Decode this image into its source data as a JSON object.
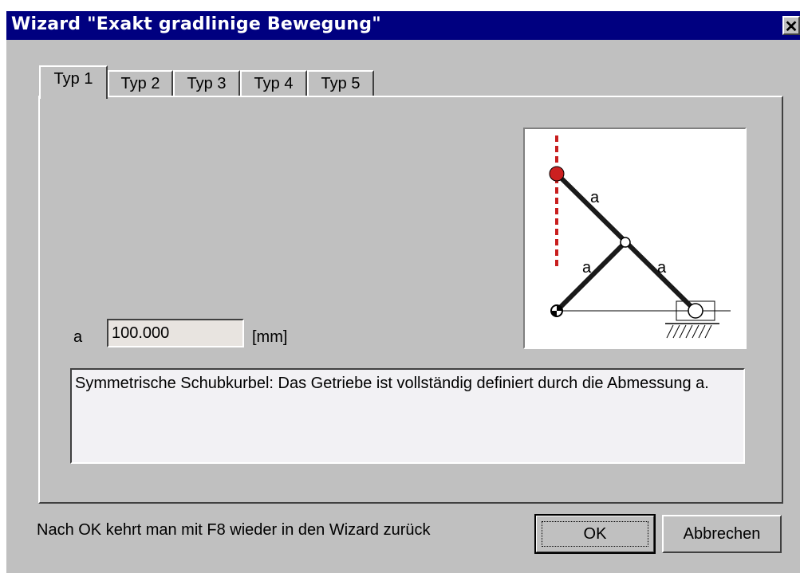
{
  "window": {
    "title": "Wizard \"Exakt gradlinige Bewegung\"",
    "close_label": "✕"
  },
  "tabs": [
    {
      "label": "Typ 1",
      "active": true
    },
    {
      "label": "Typ 2"
    },
    {
      "label": "Typ 3"
    },
    {
      "label": "Typ 4"
    },
    {
      "label": "Typ 5"
    }
  ],
  "form": {
    "param_label": "a",
    "param_value": "100.000",
    "unit": "[mm]"
  },
  "description": "Symmetrische Schubkurbel: Das Getriebe ist vollständig definiert durch die Abmessung a.",
  "diagram": {
    "link_labels": [
      "a",
      "a",
      "a"
    ],
    "colors": {
      "path": "#c81e1e",
      "link": "#1a1a1a",
      "joint": "#cc2020"
    }
  },
  "footer": {
    "note": "Nach OK kehrt man mit F8 wieder in den Wizard zurück",
    "ok_label": "OK",
    "cancel_label": "Abbrechen"
  }
}
